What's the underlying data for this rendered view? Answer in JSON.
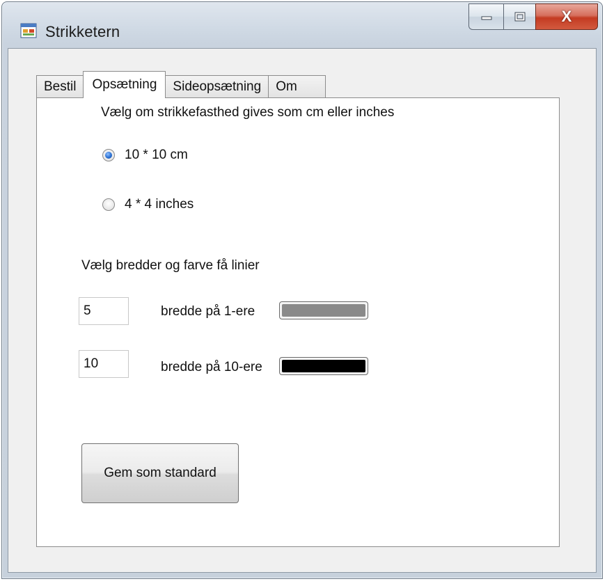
{
  "window": {
    "title": "Strikketern",
    "icon": "app-form-icon",
    "close_glyph": "X"
  },
  "tabs": [
    {
      "label": "Bestil",
      "active": false
    },
    {
      "label": "Opsætning",
      "active": true
    },
    {
      "label": "Sideopsætning",
      "active": false
    },
    {
      "label": "Om",
      "active": false
    }
  ],
  "gauge": {
    "heading": "Vælg om strikkefasthed gives som cm eller inches",
    "options": [
      {
        "label": "10 * 10 cm",
        "checked": true
      },
      {
        "label": "4 * 4 inches",
        "checked": false
      }
    ]
  },
  "lines": {
    "heading": "Vælg bredder og farve få linier",
    "rows": [
      {
        "value": "5",
        "label": "bredde på 1-ere",
        "color": "#8a8a8a"
      },
      {
        "value": "10",
        "label": "bredde på 10-ere",
        "color": "#000000"
      }
    ]
  },
  "actions": {
    "save_default_label": "Gem som standard"
  }
}
